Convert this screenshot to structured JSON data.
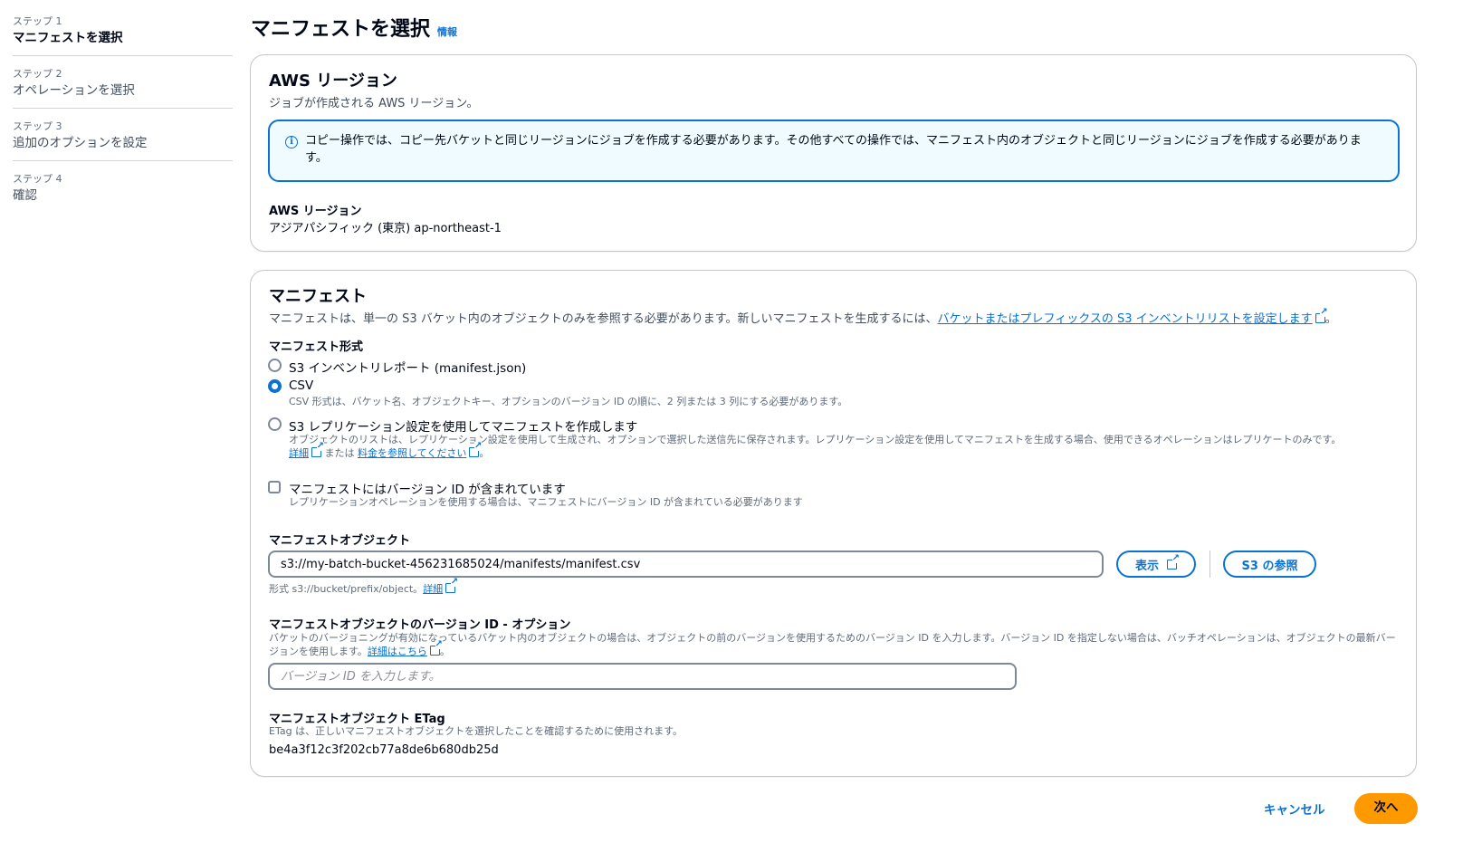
{
  "steps": [
    {
      "num": "ステップ 1",
      "label": "マニフェストを選択"
    },
    {
      "num": "ステップ 2",
      "label": "オペレーションを選択"
    },
    {
      "num": "ステップ 3",
      "label": "追加のオプションを設定"
    },
    {
      "num": "ステップ 4",
      "label": "確認"
    }
  ],
  "header": {
    "title": "マニフェストを選択",
    "info": "情報"
  },
  "region": {
    "title": "AWS リージョン",
    "desc": "ジョブが作成される AWS リージョン。",
    "alert": "コピー操作では、コピー先バケットと同じリージョンにジョブを作成する必要があります。その他すべての操作では、マニフェスト内のオブジェクトと同じリージョンにジョブを作成する必要があります。",
    "label": "AWS リージョン",
    "value": "アジアパシフィック (東京) ap-northeast-1"
  },
  "manifest": {
    "title": "マニフェスト",
    "desc_pre": "マニフェストは、単一の S3 バケット内のオブジェクトのみを参照する必要があります。新しいマニフェストを生成するには、",
    "desc_link": "バケットまたはプレフィックスの S3 インベントリリストを設定します",
    "desc_post": "。",
    "format_label": "マニフェスト形式",
    "options": [
      {
        "label": "S3 インベントリレポート (manifest.json)",
        "checked": false
      },
      {
        "label": "CSV",
        "desc": "CSV 形式は、バケット名、オブジェクトキー、オプションのバージョン ID の順に、2 列または 3 列にする必要があります。",
        "checked": true
      },
      {
        "label": "S3 レプリケーション設定を使用してマニフェストを作成します",
        "desc": "オブジェクトのリストは、レプリケーション設定を使用して生成され、オプションで選択した送信先に保存されます。レプリケーション設定を使用してマニフェストを生成する場合、使用できるオペレーションはレプリケートのみです。",
        "link1": "詳細",
        "mid": " または ",
        "link2": "料金を参照してください",
        "end": "。",
        "checked": false
      }
    ],
    "version_checkbox": {
      "label": "マニフェストにはバージョン ID が含まれています",
      "desc": "レプリケーションオペレーションを使用する場合は、マニフェストにバージョン ID が含まれている必要があります",
      "checked": false
    },
    "object": {
      "label": "マニフェストオブジェクト",
      "value": "s3://my-batch-bucket-456231685024/manifests/manifest.csv",
      "view_button": "表示",
      "browse_button": "S3 の参照",
      "hint": "形式 s3://bucket/prefix/object。",
      "hint_link": "詳細"
    },
    "version_id": {
      "label": "マニフェストオブジェクトのバージョン ID - オプション",
      "desc": "バケットのバージョニングが有効になっているバケット内のオブジェクトの場合は、オブジェクトの前のバージョンを使用するためのバージョン ID を入力します。バージョン ID を指定しない場合は、バッチオペレーションは、オブジェクトの最新バージョンを使用します。",
      "link": "詳細はこちら",
      "end": "。",
      "placeholder": "バージョン ID を入力します。"
    },
    "etag": {
      "label": "マニフェストオブジェクト ETag",
      "desc": "ETag は、正しいマニフェストオブジェクトを選択したことを確認するために使用されます。",
      "value": "be4a3f12c3f202cb77a8de6b680db25d"
    }
  },
  "footer": {
    "cancel": "キャンセル",
    "next": "次へ"
  },
  "colors": {
    "accent": "#0972d3",
    "primary_button": "#ff9900",
    "alert_bg": "#f0fbff"
  }
}
